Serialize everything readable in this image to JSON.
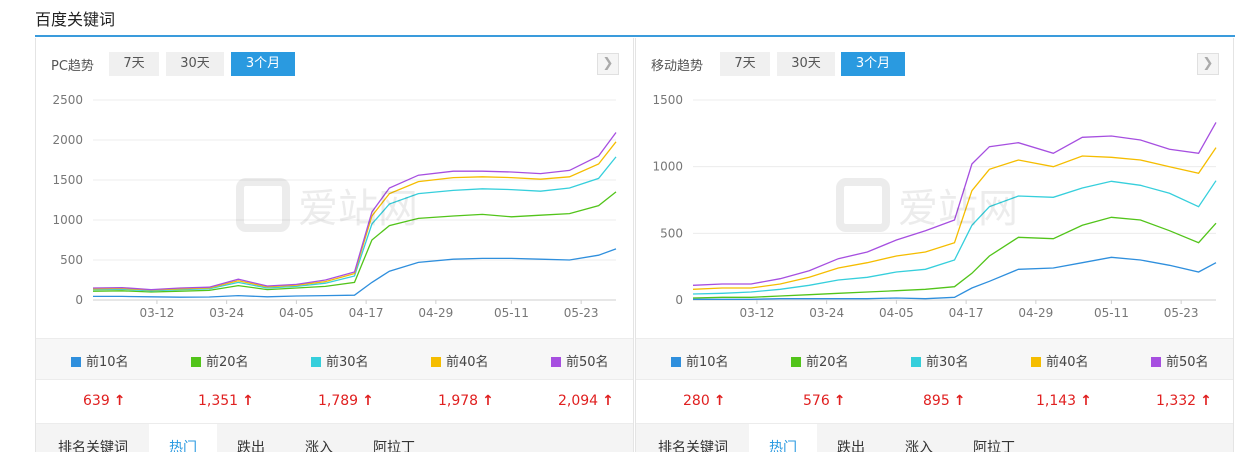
{
  "page": {
    "title": "百度关键词"
  },
  "ranges": [
    "7天",
    "30天",
    "3个月"
  ],
  "legend": [
    {
      "label": "前10名",
      "color": "#2f8fdd"
    },
    {
      "label": "前20名",
      "color": "#52c41a"
    },
    {
      "label": "前30名",
      "color": "#36cfdc"
    },
    {
      "label": "前40名",
      "color": "#f5bd00"
    },
    {
      "label": "前50名",
      "color": "#a64fe0"
    }
  ],
  "tabs": [
    "排名关键词",
    "热门",
    "跌出",
    "涨入",
    "阿拉丁"
  ],
  "watermark_text": "爱站网",
  "panels": [
    {
      "title": "PC趋势",
      "active_range": "3个月",
      "values": [
        "639",
        "1,351",
        "1,789",
        "1,978",
        "2,094"
      ],
      "chart_data": {
        "type": "line",
        "x_tick_labels": [
          "03-12",
          "03-24",
          "04-05",
          "04-17",
          "04-29",
          "05-11",
          "05-23"
        ],
        "ylim": [
          0,
          2500
        ],
        "y_ticks": [
          0,
          500,
          1000,
          1500,
          2000,
          2500
        ],
        "x": [
          "03-01",
          "03-06",
          "03-11",
          "03-16",
          "03-21",
          "03-26",
          "03-31",
          "04-05",
          "04-10",
          "04-15",
          "04-18",
          "04-21",
          "04-26",
          "05-01",
          "05-06",
          "05-11",
          "05-16",
          "05-21",
          "05-26",
          "05-29"
        ],
        "series": [
          {
            "name": "前10名",
            "values": [
              45,
              45,
              40,
              35,
              38,
              55,
              40,
              50,
              55,
              60,
              220,
              360,
              470,
              510,
              520,
              520,
              510,
              500,
              560,
              639
            ]
          },
          {
            "name": "前20名",
            "values": [
              110,
              115,
              100,
              110,
              120,
              180,
              130,
              150,
              170,
              220,
              750,
              930,
              1020,
              1050,
              1070,
              1040,
              1060,
              1080,
              1180,
              1351
            ]
          },
          {
            "name": "前30名",
            "values": [
              130,
              135,
              115,
              130,
              140,
              220,
              150,
              170,
              210,
              300,
              950,
              1200,
              1330,
              1370,
              1390,
              1380,
              1360,
              1400,
              1520,
              1789
            ]
          },
          {
            "name": "前40名",
            "values": [
              140,
              145,
              125,
              140,
              150,
              240,
              165,
              185,
              230,
              330,
              1050,
              1330,
              1480,
              1530,
              1540,
              1530,
              1510,
              1540,
              1700,
              1978
            ]
          },
          {
            "name": "前50名",
            "values": [
              150,
              155,
              130,
              150,
              160,
              260,
              175,
              195,
              250,
              350,
              1100,
              1400,
              1560,
              1610,
              1610,
              1600,
              1580,
              1620,
              1800,
              2094
            ]
          }
        ]
      }
    },
    {
      "title": "移动趋势",
      "active_range": "3个月",
      "values": [
        "280",
        "576",
        "895",
        "1,143",
        "1,332"
      ],
      "chart_data": {
        "type": "line",
        "x_tick_labels": [
          "03-12",
          "03-24",
          "04-05",
          "04-17",
          "04-29",
          "05-11",
          "05-23"
        ],
        "ylim": [
          0,
          1500
        ],
        "y_ticks": [
          0,
          500,
          1000,
          1500
        ],
        "x": [
          "03-01",
          "03-06",
          "03-11",
          "03-16",
          "03-21",
          "03-26",
          "03-31",
          "04-05",
          "04-10",
          "04-15",
          "04-18",
          "04-21",
          "04-26",
          "05-01",
          "05-06",
          "05-11",
          "05-16",
          "05-21",
          "05-26",
          "05-29"
        ],
        "series": [
          {
            "name": "前10名",
            "values": [
              5,
              5,
              5,
              10,
              10,
              10,
              10,
              15,
              10,
              20,
              90,
              140,
              230,
              240,
              280,
              320,
              300,
              260,
              210,
              280
            ]
          },
          {
            "name": "前20名",
            "values": [
              15,
              20,
              20,
              30,
              40,
              50,
              60,
              70,
              80,
              100,
              200,
              330,
              470,
              460,
              560,
              620,
              600,
              520,
              430,
              576
            ]
          },
          {
            "name": "前30名",
            "values": [
              45,
              50,
              60,
              80,
              110,
              150,
              170,
              210,
              230,
              300,
              560,
              700,
              780,
              770,
              840,
              890,
              860,
              800,
              700,
              895
            ]
          },
          {
            "name": "前40名",
            "values": [
              80,
              90,
              90,
              120,
              170,
              240,
              280,
              330,
              360,
              430,
              820,
              980,
              1050,
              1000,
              1080,
              1070,
              1050,
              1000,
              950,
              1143
            ]
          },
          {
            "name": "前50名",
            "values": [
              110,
              120,
              120,
              160,
              220,
              310,
              360,
              450,
              520,
              600,
              1020,
              1150,
              1180,
              1100,
              1220,
              1230,
              1200,
              1130,
              1100,
              1332
            ]
          }
        ]
      }
    }
  ]
}
